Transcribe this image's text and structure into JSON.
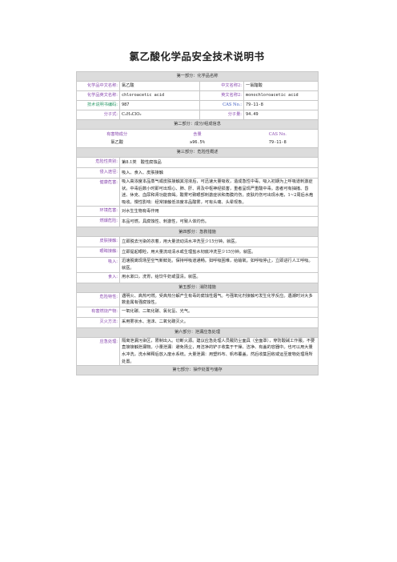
{
  "title": "氯乙酸化学品安全技术说明书",
  "s1": {
    "header": "第一部分：化学品名称",
    "rows": [
      {
        "l1": "化学品中文名称:",
        "v1": "氯乙酸",
        "l2": "中文名称2:",
        "v2": "一氯醋酸"
      },
      {
        "l1": "化学品英文名称:",
        "v1": "chloroacetic acid",
        "l2": "英文名称2:",
        "v2": "monochloroacetic acid"
      },
      {
        "l1": "技术说明书编码:",
        "v1": "987",
        "l2": "CAS No.:",
        "v2": "79-11-8"
      },
      {
        "l1": "分子式:",
        "v1": "C₂H₃ClO₂",
        "l2": "分子量:",
        "v2": "94.49"
      }
    ]
  },
  "s2": {
    "header": "第二部分：成分/组成信息",
    "cols": [
      "有害物成分",
      "含量",
      "CAS No."
    ],
    "row": [
      "氯乙酸",
      "≥96.5%",
      "79-11-8"
    ]
  },
  "s3": {
    "header": "第三部分：危险性概述",
    "rows": [
      {
        "l": "危险性类别:",
        "v": "第8.1类　酸性腐蚀品"
      },
      {
        "l": "侵入途径:",
        "v": "吸入、食入、皮肤接触"
      },
      {
        "l": "健康危害:",
        "v": "吸入高浓度本品蒸气或皮肤接触其溶液后，可迅速大量吸收，造成急性中毒。吸入初期为上呼吸道刺激症状。中毒后数小时即可出现心、肺、肝、肾及中枢神经损害，重者呈现严重酸中毒。患者可有抽搐、昏迷、休克、血尿和肾功能衰竭。酸雾可致眼部刺激症状和角膜灼伤。皮肤灼伤可出现水疱，1~2周后水疱吸收。慢性影响：经常接触低浓度本品酸雾，可有头痛、头晕现象。"
      },
      {
        "l": "环境危害:",
        "v": "对水生生物有毒作用"
      },
      {
        "l": "燃爆危险:",
        "v": "本品可燃，具腐蚀性、刺激性，可致人体灼伤。"
      }
    ]
  },
  "s4": {
    "header": "第四部分：急救措施",
    "rows": [
      {
        "l": "皮肤接触:",
        "v": "立即脱去污染的衣着，用大量流动清水冲洗至少15分钟。就医。"
      },
      {
        "l": "眼睛接触:",
        "v": "立即提起眼睑，用大量流动清水或生理盐水彻底冲洗至少15分钟。就医。"
      },
      {
        "l": "吸入:",
        "v": "迅速脱离现场至空气新鲜处。保持呼吸道通畅。如呼吸困难，给输氧。如呼吸停止，立即进行人工呼吸。就医。"
      },
      {
        "l": "食入:",
        "v": "用水漱口，洗胃，给饮牛奶或蛋清。就医。"
      }
    ]
  },
  "s5": {
    "header": "第五部分：消防措施",
    "rows": [
      {
        "l": "危险特性:",
        "v": "遇明火、高热可燃。受高热分解产生有毒的腐蚀性烟气。与强氧化剂接触可发生化学反应。遇潮时对大多数金属有强腐蚀性。"
      },
      {
        "l": "有害燃烧产物:",
        "v": "一氧化碳、二氧化碳、氯化氢、光气。"
      },
      {
        "l": "灭火方法:",
        "v": "采用雾状水、泡沫、二氧化碳灭火。"
      }
    ]
  },
  "s6": {
    "header": "第六部分：泄漏应急处理",
    "rows": [
      {
        "l": "应急处理:",
        "v": "隔离泄漏污染区，限制出入。切断火源。建议应急处理人员戴防尘面具（全面罩），穿防酸碱工作服。不要直接接触泄漏物。小量泄漏：避免扬尘，用洁净的铲子收集于干燥、洁净、有盖的容器中。也可以用大量水冲洗，洗水稀释后放入废水系统。大量泄漏：用塑料布、帆布覆盖。然后收集回收或运至废物处理场所处置。"
      }
    ]
  },
  "s7": {
    "header": "第七部分：操作处置与储存"
  },
  "colors": {
    "label": "#8a4bb0",
    "section_bg": "#dcdcdc"
  }
}
